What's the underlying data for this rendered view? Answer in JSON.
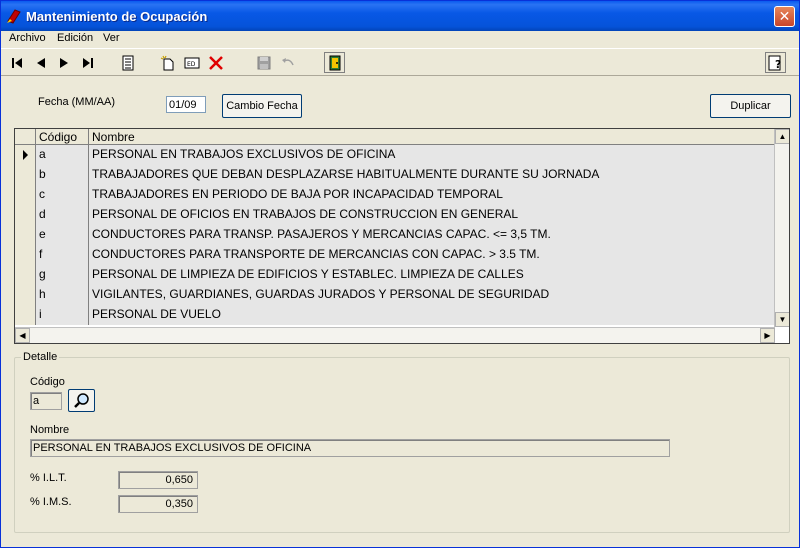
{
  "window": {
    "title": "Mantenimiento de Ocupación",
    "close_label": "✕"
  },
  "menu": {
    "items": [
      "Archivo",
      "Edición",
      "Ver"
    ]
  },
  "toolbar": {
    "buttons": [
      "first-record",
      "prev-record",
      "next-record",
      "last-record",
      "list-view",
      "new-record",
      "edit-record",
      "delete-record",
      "save-record",
      "undo",
      "exit",
      "help"
    ]
  },
  "header": {
    "fecha_label": "Fecha (MM/AA)",
    "fecha_value": "01/09",
    "cambio_fecha_label": "Cambio Fecha",
    "duplicar_label": "Duplicar"
  },
  "grid": {
    "columns": [
      "Código",
      "Nombre"
    ],
    "rows": [
      {
        "codigo": "a",
        "nombre": "PERSONAL EN TRABAJOS EXCLUSIVOS DE OFICINA"
      },
      {
        "codigo": "b",
        "nombre": "TRABAJADORES QUE DEBAN DESPLAZARSE HABITUALMENTE DURANTE SU JORNADA"
      },
      {
        "codigo": "c",
        "nombre": "TRABAJADORES EN PERIODO DE BAJA POR INCAPACIDAD TEMPORAL"
      },
      {
        "codigo": "d",
        "nombre": "PERSONAL DE OFICIOS EN TRABAJOS DE CONSTRUCCION EN GENERAL"
      },
      {
        "codigo": "e",
        "nombre": "CONDUCTORES PARA TRANSP. PASAJEROS Y MERCANCIAS CAPAC. <= 3,5 TM."
      },
      {
        "codigo": "f",
        "nombre": "CONDUCTORES PARA TRANSPORTE DE MERCANCIAS CON CAPAC. > 3.5 TM."
      },
      {
        "codigo": "g",
        "nombre": "PERSONAL DE LIMPIEZA DE EDIFICIOS Y ESTABLEC. LIMPIEZA DE CALLES"
      },
      {
        "codigo": "h",
        "nombre": "VIGILANTES, GUARDIANES, GUARDAS JURADOS Y PERSONAL DE SEGURIDAD"
      },
      {
        "codigo": "i",
        "nombre": "PERSONAL DE VUELO"
      }
    ],
    "selected_index": 0
  },
  "detalle": {
    "title": "Detalle",
    "codigo_label": "Código",
    "codigo_value": "a",
    "nombre_label": "Nombre",
    "nombre_value": "PERSONAL EN TRABAJOS EXCLUSIVOS DE OFICINA",
    "ilt_label": "% I.L.T.",
    "ilt_value": "0,650",
    "ims_label": "% I.M.S.",
    "ims_value": "0,350"
  },
  "colors": {
    "titlebar": "#0858E6",
    "window_bg": "#ECE9D8",
    "row_bg": "#E6E6E6"
  }
}
